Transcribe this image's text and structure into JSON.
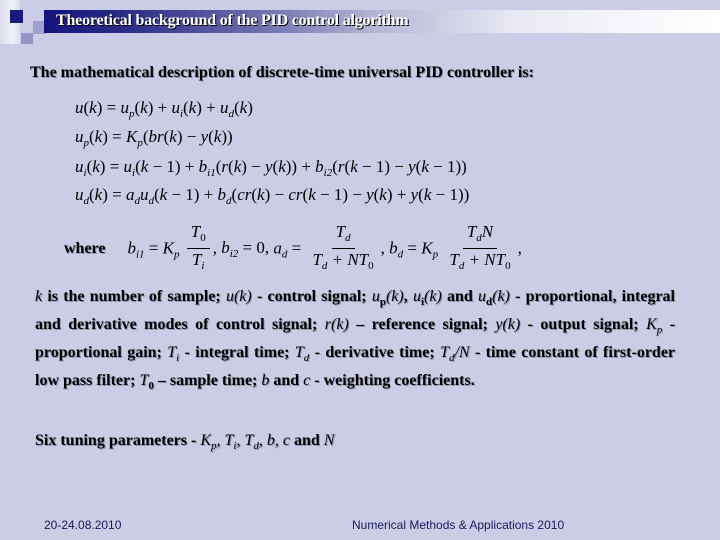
{
  "slide": {
    "title": "Theoretical background of the PID control algorithm",
    "intro": "The mathematical description of discrete-time universal PID controller is:",
    "colors": {
      "background": "#cbcce6",
      "title_bar_start": "#14147a",
      "title_bar_end": "#ffffff",
      "footer_text": "#1a1a60"
    }
  },
  "equations": {
    "eq1": {
      "lhs": "u(k)",
      "rhs": "u_p(k) + u_i(k) + u_d(k)"
    },
    "eq2": {
      "lhs": "u_p(k)",
      "rhs": "K_p(br(k) − y(k))"
    },
    "eq3": {
      "lhs": "u_i(k)",
      "rhs": "u_i(k − 1) + b_i1(r(k) − y(k)) + b_i2(r(k − 1) − y(k − 1))"
    },
    "eq4": {
      "lhs": "u_d(k)",
      "rhs": "a_d u_d(k − 1) + b_d(cr(k) − cr(k − 1) − y(k) + y(k − 1))"
    }
  },
  "where": {
    "label": "where",
    "bi1": {
      "lhs": "b",
      "lhs_sub": "i1",
      "coef": "K",
      "coef_sub": "p",
      "num": "T",
      "num_sub": "0",
      "den": "T",
      "den_sub": "i"
    },
    "bi2": {
      "lhs": "b",
      "lhs_sub": "i2",
      "value": "0"
    },
    "ad": {
      "lhs": "a",
      "lhs_sub": "d",
      "num": "T",
      "num_sub": "d",
      "den": "T",
      "den_sub": "d",
      "den_rest": "+ NT",
      "den_rest_sub": "0"
    },
    "bd": {
      "lhs": "b",
      "lhs_sub": "d",
      "coef": "K",
      "coef_sub": "p",
      "num": "T",
      "num_sub": "d",
      "num_rest": "N",
      "den": "T",
      "den_sub": "d",
      "den_rest": "+ NT",
      "den_rest_sub": "0"
    }
  },
  "definitions": {
    "k": "k",
    "k_text": " is the number of sample; ",
    "u": "u(k)",
    "u_text": " - control signal; ",
    "up": "u",
    "up_sub": "p",
    "up_arg": "(k)",
    "sep1": ", ",
    "ui": "u",
    "ui_sub": "i",
    "ui_arg": "(k)",
    "and1": " and ",
    "ud": "u",
    "ud_sub": "d",
    "ud_arg": "(k)",
    "modes_text": " - proportional, integral and derivative modes of control signal; ",
    "r": "r(k)",
    "r_text": " – reference signal; ",
    "y": "y(k)",
    "y_text": " - output signal; ",
    "kp": "K",
    "kp_sub": "p",
    "kp_text": " - proportional gain; ",
    "ti": "T",
    "ti_sub": "i",
    "ti_text": " - integral time; ",
    "td": "T",
    "td_sub": "d",
    "td_text": " - derivative time; ",
    "tdn": "T",
    "tdn_sub": "d",
    "tdn_rest": "/N",
    "tdn_text": " - time constant of first-order low pass filter; ",
    "t0": "T",
    "t0_sub": "0",
    "t0_text": " – sample time; ",
    "b": "b",
    "and2": " and ",
    "c": "c",
    "bc_text": " - weighting coefficients."
  },
  "tuning": {
    "prefix": "Six tuning parameters - ",
    "kp": "K",
    "kp_sub": "p",
    "s1": ", ",
    "ti": "T",
    "ti_sub": "i",
    "s2": ", ",
    "td": "T",
    "td_sub": "d",
    "s3": ", ",
    "b": "b",
    "s4": ", ",
    "c": "c",
    "and": " and ",
    "n": "N"
  },
  "footer": {
    "date": "20-24.08.2010",
    "conference": "Numerical Methods & Applications 2010"
  }
}
